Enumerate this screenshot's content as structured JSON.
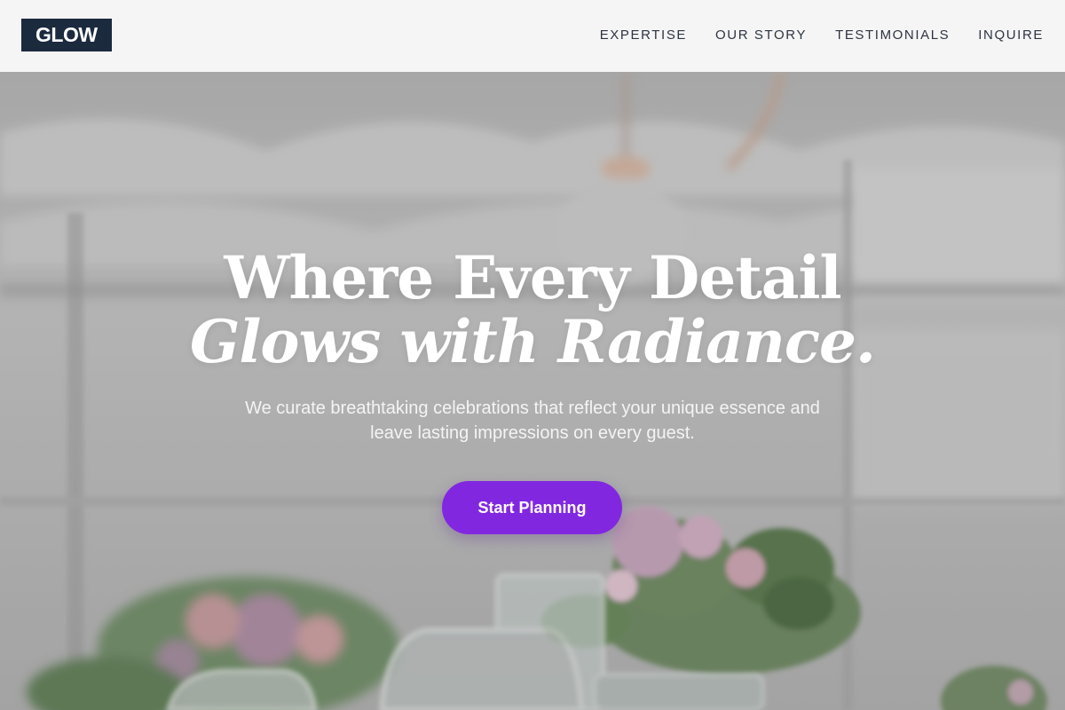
{
  "brand": {
    "logo_text": "GLOW",
    "logo_bg": "#1c2a3e"
  },
  "nav": {
    "items": [
      {
        "label": "EXPERTISE"
      },
      {
        "label": "OUR STORY"
      },
      {
        "label": "TESTIMONIALS"
      },
      {
        "label": "INQUIRE"
      }
    ]
  },
  "hero": {
    "headline_line1": "Where Every Detail",
    "headline_line2": "Glows with Radiance.",
    "subtitle": "We curate breathtaking celebrations that reflect your unique essence and leave lasting impressions on every guest.",
    "cta_label": "Start Planning",
    "cta_color": "#8227e0"
  }
}
